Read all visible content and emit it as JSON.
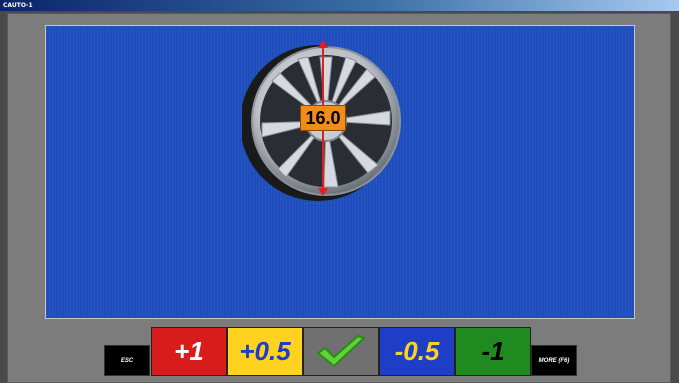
{
  "window": {
    "title": "CAUTO-1"
  },
  "display": {
    "rim_size": "16.0"
  },
  "controls": {
    "esc_label": "ESC",
    "plus_one_label": "+1",
    "plus_half_label": "+0.5",
    "minus_half_label": "-0.5",
    "minus_one_label": "-1",
    "more_label": "MORE (F6)"
  },
  "colors": {
    "panel": "#1f4fbf",
    "plus_one": "#d81c1c",
    "plus_half": "#ffd21f",
    "confirm": "#707070",
    "minus_half": "#1e3ec8",
    "minus_one": "#1f8a1f",
    "measure_arrow": "#e02020",
    "size_box": "#f08c1a"
  },
  "icons": {
    "confirm": "checkmark-icon",
    "wheel": "alloy-wheel-image"
  }
}
